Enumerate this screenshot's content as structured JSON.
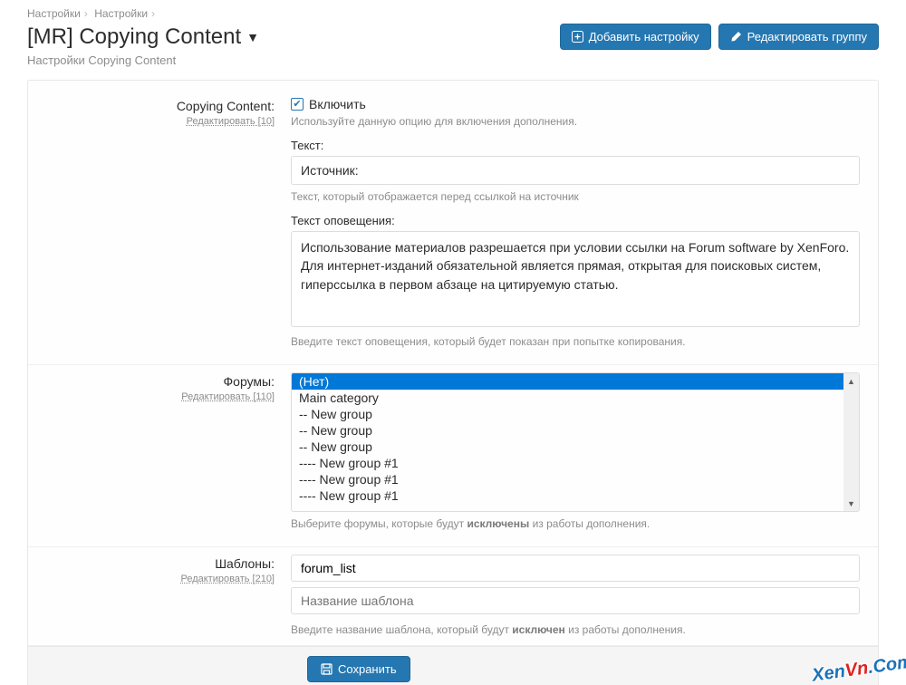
{
  "breadcrumbs": {
    "a": "Настройки",
    "b": "Настройки"
  },
  "header": {
    "title": "[MR] Copying Content",
    "subtitle": "Настройки Copying Content",
    "add_btn": "Добавить настройку",
    "edit_btn": "Редактировать группу"
  },
  "section1": {
    "label": "Copying Content:",
    "edit": "Редактировать [10]",
    "enable": "Включить",
    "enable_hint": "Используйте данную опцию для включения дополнения.",
    "text_label": "Текст:",
    "text_value": "Источник:",
    "text_hint": "Текст, который отображается перед ссылкой на источник",
    "alert_label": "Текст оповещения:",
    "alert_value": "Использование материалов разрешается при условии ссылки на Forum software by XenForo. Для интернет-изданий обязательной является прямая, открытая для поисковых систем, гиперссылка в первом абзаце на цитируемую статью.",
    "alert_hint": "Введите текст оповещения, который будет показан при попытке копирования."
  },
  "section2": {
    "label": "Форумы:",
    "edit": "Редактировать [110]",
    "options": [
      "(Нет)",
      "Main category",
      "-- New group",
      "-- New group",
      "-- New group",
      "---- New group #1",
      "---- New group #1",
      "---- New group #1"
    ],
    "hint_pre": "Выберите форумы, которые будут ",
    "hint_b": "исключены",
    "hint_post": " из работы дополнения."
  },
  "section3": {
    "label": "Шаблоны:",
    "edit": "Редактировать [210]",
    "value": "forum_list",
    "placeholder": "Название шаблона",
    "hint_pre": "Введите название шаблона, который будут ",
    "hint_b": "исключен",
    "hint_post": " из работы дополнения."
  },
  "footer": {
    "save": "Сохранить"
  },
  "watermark": {
    "a": "Xen",
    "b": "Vn",
    "c": ".Com"
  }
}
